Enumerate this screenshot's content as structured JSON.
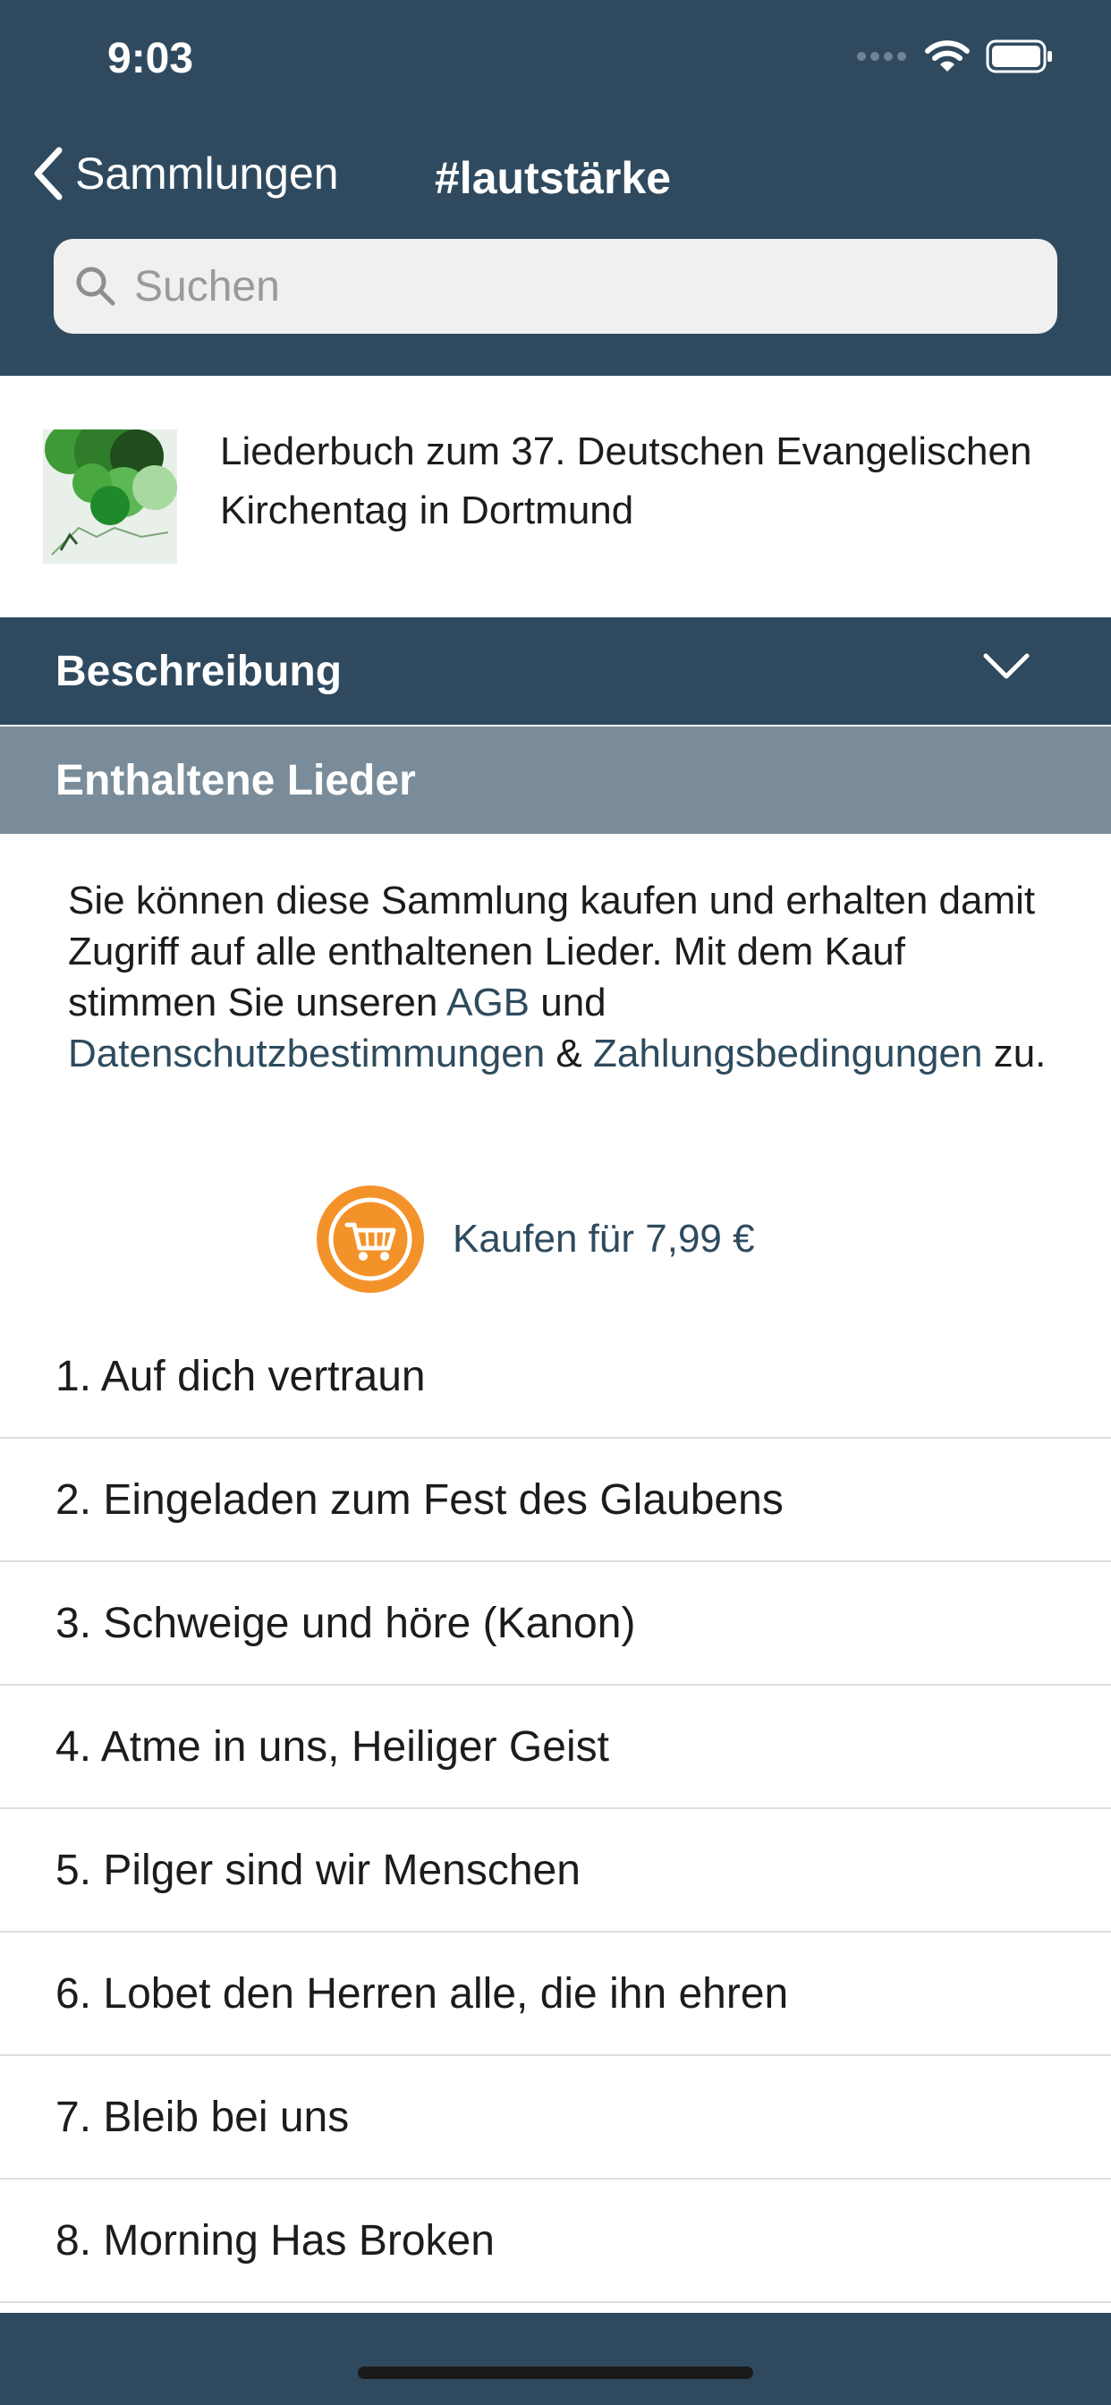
{
  "status_bar": {
    "time": "9:03"
  },
  "nav": {
    "back_label": "Sammlungen",
    "title": "#lautstärke"
  },
  "search": {
    "placeholder": "Suchen"
  },
  "book": {
    "title": "Liederbuch zum 37. Deutschen Evangelischen Kirchentag in Dortmund"
  },
  "sections": {
    "description": "Beschreibung",
    "songs": "Enthaltene Lieder"
  },
  "purchase_info": {
    "text_1": "Sie können diese Sammlung kaufen und erhalten damit Zugriff auf alle enthaltenen Lieder. Mit dem Kauf stimmen Sie unseren ",
    "link_agb": "AGB",
    "text_2": " und ",
    "link_privacy": "Datenschutzbestimmungen",
    "text_3": " & ",
    "link_payment": "Zahlungsbedingungen",
    "text_4": " zu."
  },
  "buy": {
    "label": "Kaufen für 7,99 €"
  },
  "songs": [
    "1. Auf dich vertraun",
    "2. Eingeladen zum Fest des Glaubens",
    "3. Schweige und höre (Kanon)",
    "4. Atme in uns, Heiliger Geist",
    "5. Pilger sind wir Menschen",
    "6. Lobet den Herren alle, die ihn ehren",
    "7. Bleib bei uns",
    "8. Morning Has Broken"
  ],
  "colors": {
    "nav_bg": "#2f4a5f",
    "section_songs_bg": "#7a8c99",
    "accent_orange": "#f4922a",
    "link": "#2e4b5e"
  }
}
